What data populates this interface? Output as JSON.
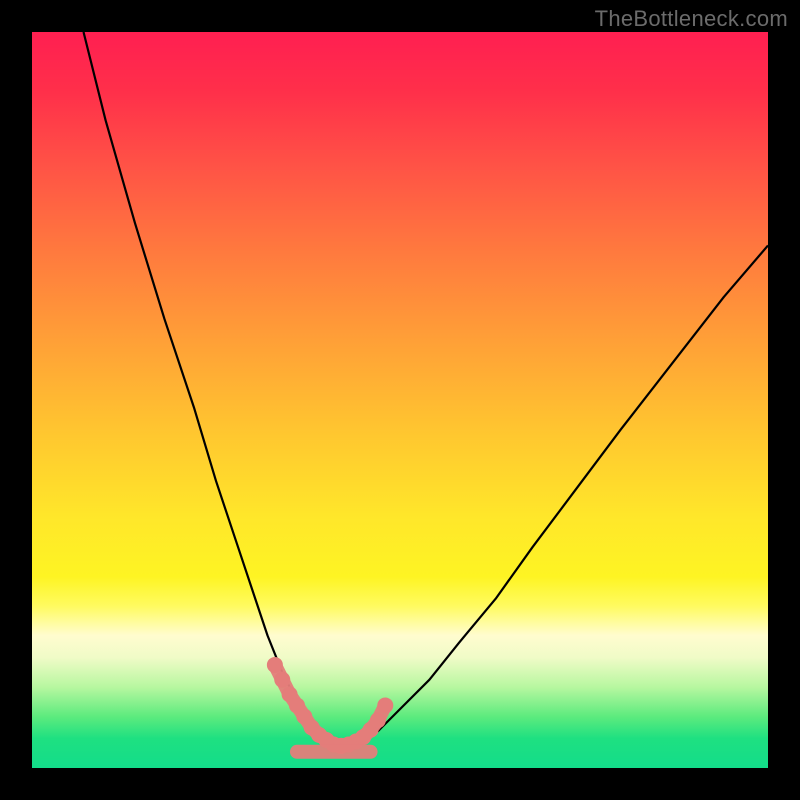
{
  "watermark": {
    "text": "TheBottleneck.com"
  },
  "chart_data": {
    "type": "line",
    "title": "",
    "xlabel": "",
    "ylabel": "",
    "xlim": [
      0,
      100
    ],
    "ylim": [
      0,
      100
    ],
    "grid": false,
    "legend": false,
    "series": [
      {
        "name": "bottleneck-curve-left",
        "color": "#000000",
        "x": [
          7,
          10,
          14,
          18,
          22,
          25,
          28,
          30,
          32,
          34,
          36,
          38,
          40,
          42
        ],
        "y": [
          100,
          88,
          74,
          61,
          49,
          39,
          30,
          24,
          18,
          13,
          9,
          6,
          4,
          3
        ]
      },
      {
        "name": "bottleneck-curve-right",
        "color": "#000000",
        "x": [
          42,
          44,
          47,
          50,
          54,
          58,
          63,
          68,
          74,
          80,
          87,
          94,
          100
        ],
        "y": [
          3,
          4,
          5,
          8,
          12,
          17,
          23,
          30,
          38,
          46,
          55,
          64,
          71
        ]
      },
      {
        "name": "highlight-band-left",
        "color": "#e47d7a",
        "x": [
          33,
          34,
          35,
          36,
          37,
          38,
          39,
          40,
          41,
          42
        ],
        "y": [
          14,
          12,
          10,
          8.5,
          7,
          5.5,
          4.5,
          3.8,
          3.2,
          3
        ]
      },
      {
        "name": "highlight-band-right",
        "color": "#e47d7a",
        "x": [
          42,
          43,
          44,
          45,
          46,
          47,
          48
        ],
        "y": [
          3,
          3.2,
          3.6,
          4.2,
          5.2,
          6.5,
          8.5
        ]
      },
      {
        "name": "highlight-floor",
        "color": "#e47d7a",
        "x": [
          36,
          38,
          40,
          42,
          44,
          46
        ],
        "y": [
          2.2,
          2.2,
          2.2,
          2.2,
          2.2,
          2.2
        ]
      }
    ]
  }
}
